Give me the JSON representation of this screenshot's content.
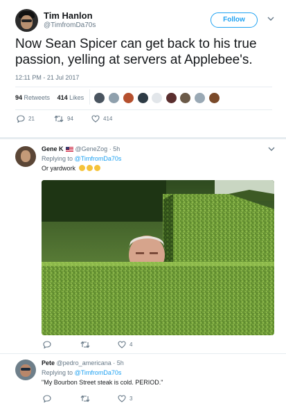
{
  "main_tweet": {
    "author_name": "Tim Hanlon",
    "author_handle": "@TimfromDa70s",
    "follow_label": "Follow",
    "text": "Now Sean Spicer can get back to his true passion, yelling at servers at Applebee's.",
    "timestamp": "12:11 PM - 21 Jul 2017",
    "retweets_count": "94",
    "retweets_label": "Retweets",
    "likes_count": "414",
    "likes_label": "Likes",
    "actions": {
      "reply_count": "21",
      "retweet_count": "94",
      "like_count": "414"
    }
  },
  "replies": [
    {
      "name": "Gene K",
      "handle": "@GeneZog",
      "time": "· 5h",
      "replying_label": "Replying to",
      "replying_to": "@TimfromDa70s",
      "text": "Or yardwork",
      "emojis": [
        "grinning-face",
        "smiling-face",
        "sweat-smile-face"
      ],
      "has_photo": true,
      "actions": {
        "reply_count": "",
        "retweet_count": "",
        "like_count": "4"
      }
    },
    {
      "name": "Pete",
      "handle": "@pedro_americana",
      "time": "· 5h",
      "replying_label": "Replying to",
      "replying_to": "@TimfromDa70s",
      "text": "\"My Bourbon Street steak is cold. PERIOD.\"",
      "has_photo": false,
      "actions": {
        "reply_count": "",
        "retweet_count": "",
        "like_count": "3"
      }
    }
  ],
  "icons": {
    "reply": "reply-icon",
    "retweet": "retweet-icon",
    "like": "heart-icon",
    "more": "chevron-down-icon"
  },
  "colors": {
    "accent": "#1da1f2",
    "text": "#14171a",
    "muted": "#657786",
    "divider": "#e6ecf0"
  }
}
